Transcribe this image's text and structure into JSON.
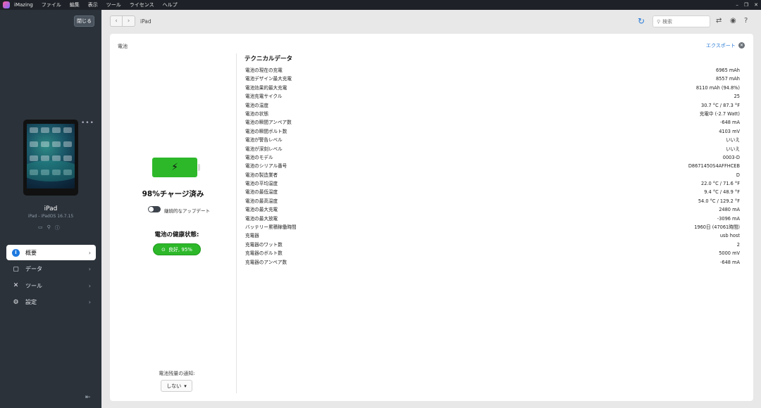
{
  "menubar": {
    "app": "iMazing",
    "items": [
      "ファイル",
      "編集",
      "表示",
      "ツール",
      "ライセンス",
      "ヘルプ"
    ]
  },
  "sidebar": {
    "close_label": "閉じる",
    "device_name": "iPad",
    "device_sub": "iPad - iPadOS 16.7.15",
    "nav": [
      {
        "label": "概要",
        "icon": "info-icon",
        "active": true
      },
      {
        "label": "データ",
        "icon": "data-icon",
        "active": false
      },
      {
        "label": "ツール",
        "icon": "tools-icon",
        "active": false
      },
      {
        "label": "設定",
        "icon": "gear-icon",
        "active": false
      }
    ]
  },
  "toolbar": {
    "breadcrumb": "iPad",
    "search_placeholder": "検索"
  },
  "panel": {
    "title": "電池",
    "export_label": "エクスポート",
    "charge_title": "98%チャージ済み",
    "toggle_label": "継続的なアップデート",
    "health_label": "電池の健康状態:",
    "health_value": "良好, 95%",
    "notify_label": "電池残量の通知:",
    "notify_value": "しない",
    "battery_level": 0.98
  },
  "tech": {
    "title": "テクニカルデータ",
    "rows": [
      {
        "k": "電池の現在の充電",
        "v": "6965 mAh"
      },
      {
        "k": "電池デザイン最大充電",
        "v": "8557 mAh"
      },
      {
        "k": "電池効果的最大充電",
        "v": "8110 mAh (94.8%)"
      },
      {
        "k": "電池充電サイクル",
        "v": "25"
      },
      {
        "k": "電池の温度",
        "v": "30.7 °C / 87.3 °F"
      },
      {
        "k": "電池の状態",
        "v": "充電中 (-2.7 Watt)"
      },
      {
        "k": "電池の瞬間アンペア数",
        "v": "-648 mA"
      },
      {
        "k": "電池の瞬間ボルト数",
        "v": "4103 mV"
      },
      {
        "k": "電池が警告レベル",
        "v": "いいえ"
      },
      {
        "k": "電池が深刻レベル",
        "v": "いいえ"
      },
      {
        "k": "電池のモデル",
        "v": "0003-D"
      },
      {
        "k": "電池のシリアル番号",
        "v": "D8671450S4AFFHCEB"
      },
      {
        "k": "電池の製造業者",
        "v": "D"
      },
      {
        "k": "電池の平均温度",
        "v": "22.0 °C / 71.6 °F"
      },
      {
        "k": "電池の最低温度",
        "v": "9.4 °C / 48.9 °F"
      },
      {
        "k": "電池の最高温度",
        "v": "54.0 °C / 129.2 °F"
      },
      {
        "k": "電池の最大充電",
        "v": "2480 mA"
      },
      {
        "k": "電池の最大放電",
        "v": "-3096 mA"
      },
      {
        "k": "バッテリー累積稼働時間",
        "v": "1960日 (47061時間)"
      },
      {
        "k": "充電器",
        "v": "usb host"
      },
      {
        "k": "充電器のワット数",
        "v": "2"
      },
      {
        "k": "充電器のボルト数",
        "v": "5000 mV"
      },
      {
        "k": "充電器のアンペア数",
        "v": "-648 mA"
      }
    ]
  }
}
